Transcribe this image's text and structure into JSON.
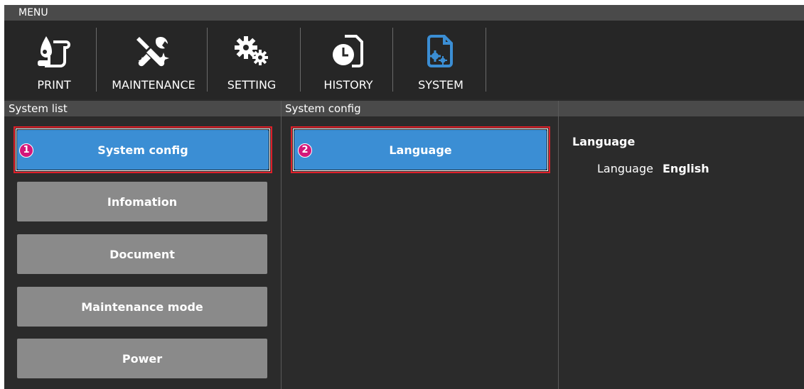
{
  "menu": {
    "title": "MENU"
  },
  "toolbar": {
    "items": [
      {
        "label": "PRINT",
        "icon": "print-icon"
      },
      {
        "label": "MAINTENANCE",
        "icon": "maintenance-icon"
      },
      {
        "label": "SETTING",
        "icon": "setting-icon"
      },
      {
        "label": "HISTORY",
        "icon": "history-icon"
      },
      {
        "label": "SYSTEM",
        "icon": "system-icon",
        "active": true
      }
    ]
  },
  "colors": {
    "accent": "#3b8ed4",
    "highlight": "#e0202a",
    "marker": "#d4177a"
  },
  "system_list": {
    "header": "System list",
    "items": [
      {
        "label": "System config",
        "selected": true,
        "marker": "1"
      },
      {
        "label": "Infomation"
      },
      {
        "label": "Document"
      },
      {
        "label": "Maintenance mode"
      },
      {
        "label": "Power"
      }
    ]
  },
  "system_config": {
    "header": "System config",
    "items": [
      {
        "label": "Language",
        "selected": true,
        "marker": "2"
      }
    ]
  },
  "details": {
    "header": "",
    "title": "Language",
    "rows": [
      {
        "key": "Language",
        "value": "English"
      }
    ]
  }
}
